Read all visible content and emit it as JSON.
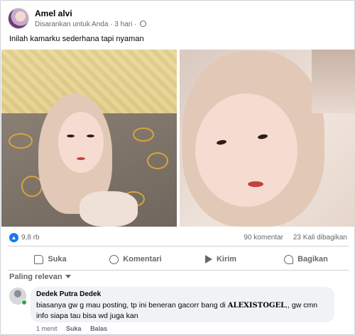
{
  "post": {
    "author": "Amel alvi",
    "suggested": "Disarankan untuk Anda",
    "time": "3 hari",
    "caption": "Inilah kamarku sederhana tapi nyaman"
  },
  "stats": {
    "reactions": "9,8 rb",
    "comments": "90 komentar",
    "shares": "23 Kali dibagikan"
  },
  "actions": {
    "like": "Suka",
    "comment": "Komentari",
    "send": "Kirim",
    "share": "Bagikan"
  },
  "sort": {
    "label": "Paling relevan"
  },
  "comment": {
    "author": "Dedek Putra Dedek",
    "text_before": "biasanya gw g mau posting, tp ini beneran gacorr bang di ",
    "text_bold": "ALEXISTOGEL",
    "text_after": ",, gw cmn info siapa tau bisa wd juga kan",
    "time": "1 menit",
    "like": "Suka",
    "reply": "Balas"
  },
  "icons": {
    "avatar": "profile-avatar",
    "globe": "globe-icon",
    "like_badge": "thumbs-up-icon",
    "like": "thumbs-up-icon",
    "comment": "comment-bubble-icon",
    "send": "send-icon",
    "share": "share-icon",
    "chevron": "chevron-down-icon"
  },
  "colors": {
    "accent": "#1877f2",
    "secondary_text": "#65676b",
    "bubble": "#f0f2f5",
    "online": "#31a24c"
  }
}
